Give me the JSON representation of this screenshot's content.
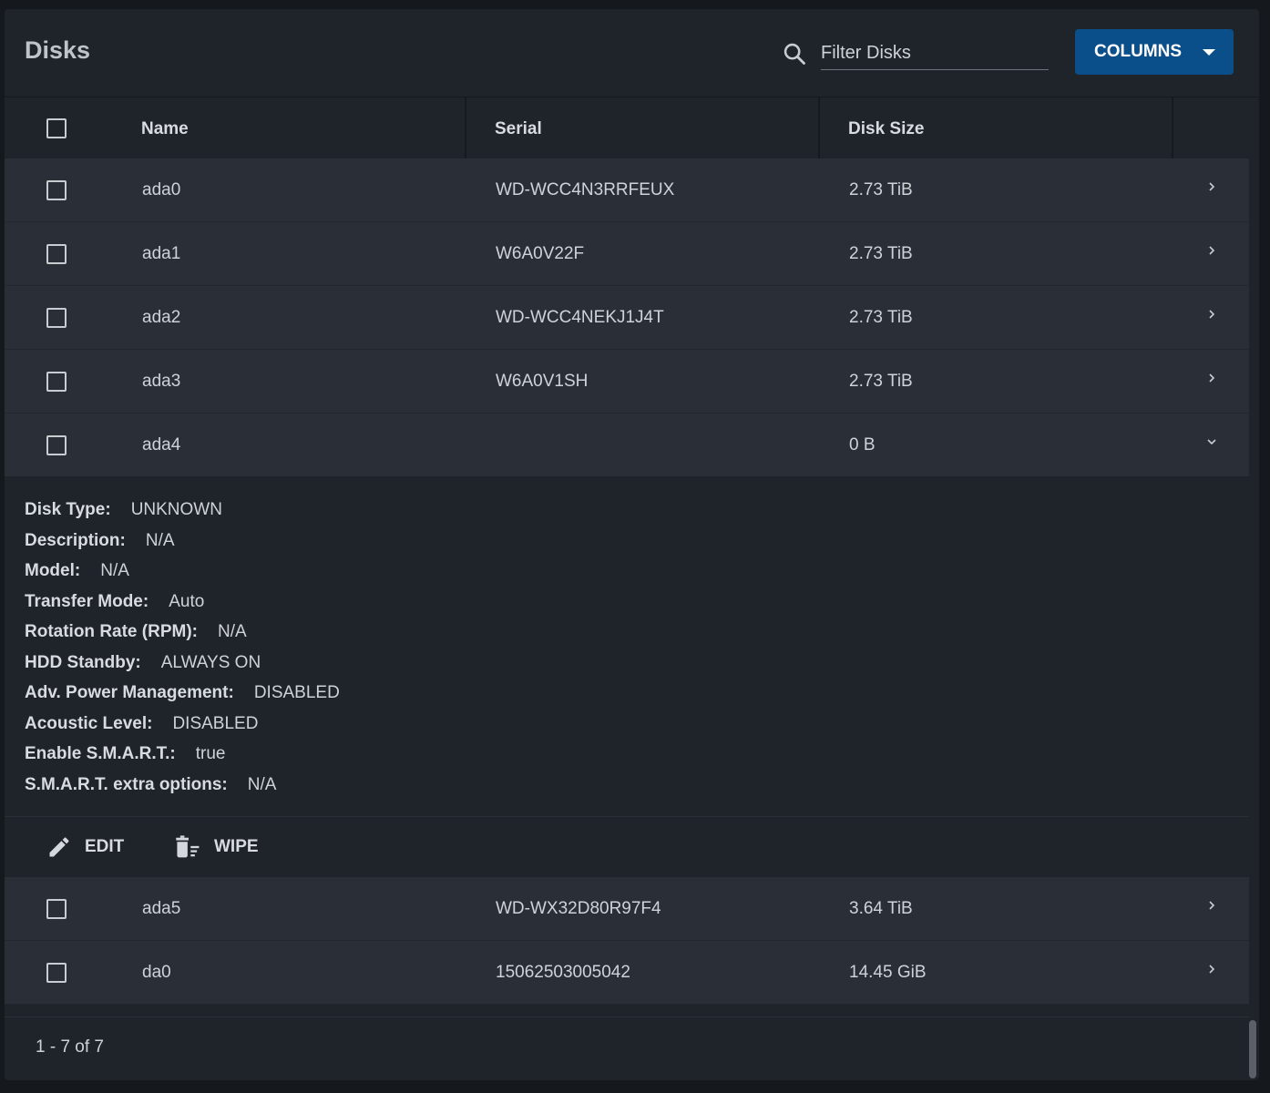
{
  "header": {
    "title": "Disks",
    "filter_placeholder": "Filter Disks",
    "columns_label": "COLUMNS"
  },
  "table": {
    "columns": [
      "Name",
      "Serial",
      "Disk Size"
    ],
    "rows": [
      {
        "name": "ada0",
        "serial": "WD-WCC4N3RRFEUX",
        "size": "2.73 TiB"
      },
      {
        "name": "ada1",
        "serial": "W6A0V22F",
        "size": "2.73 TiB"
      },
      {
        "name": "ada2",
        "serial": "WD-WCC4NEKJ1J4T",
        "size": "2.73 TiB"
      },
      {
        "name": "ada3",
        "serial": "W6A0V1SH",
        "size": "2.73 TiB"
      },
      {
        "name": "ada4",
        "serial": "",
        "size": "0 B"
      },
      {
        "name": "ada5",
        "serial": "WD-WX32D80R97F4",
        "size": "3.64 TiB"
      },
      {
        "name": "da0",
        "serial": "15062503005042",
        "size": "14.45 GiB"
      }
    ]
  },
  "details": [
    {
      "label": "Disk Type:",
      "value": "UNKNOWN"
    },
    {
      "label": "Description:",
      "value": "N/A"
    },
    {
      "label": "Model:",
      "value": "N/A"
    },
    {
      "label": "Transfer Mode:",
      "value": "Auto"
    },
    {
      "label": "Rotation Rate (RPM):",
      "value": "N/A"
    },
    {
      "label": "HDD Standby:",
      "value": "ALWAYS ON"
    },
    {
      "label": "Adv. Power Management:",
      "value": "DISABLED"
    },
    {
      "label": "Acoustic Level:",
      "value": "DISABLED"
    },
    {
      "label": "Enable S.M.A.R.T.:",
      "value": "true"
    },
    {
      "label": "S.M.A.R.T. extra options:",
      "value": "N/A"
    }
  ],
  "actions": {
    "edit_label": "EDIT",
    "wipe_label": "WIPE"
  },
  "footer": {
    "pagination": "1 - 7 of 7"
  },
  "colors": {
    "accent": "#0b4f8a",
    "row_bg": "#2a2f37",
    "panel_bg": "#1f242b"
  }
}
